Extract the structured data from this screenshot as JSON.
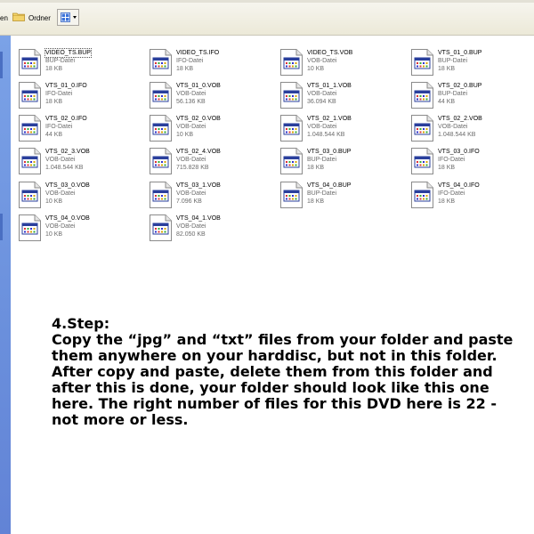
{
  "toolbar": {
    "cut_label": "en",
    "folder_label": "Ordner",
    "view_icon": "thumbnails-view-icon"
  },
  "files": [
    {
      "name": "VIDEO_TS.BUP",
      "type": "BUP-Datei",
      "size": "18 KB",
      "selected": true
    },
    {
      "name": "VIDEO_TS.IFO",
      "type": "IFO-Datei",
      "size": "18 KB"
    },
    {
      "name": "VIDEO_TS.VOB",
      "type": "VOB-Datei",
      "size": "10 KB"
    },
    {
      "name": "VTS_01_0.BUP",
      "type": "BUP-Datei",
      "size": "18 KB"
    },
    {
      "name": "VTS_01_0.IFO",
      "type": "IFO-Datei",
      "size": "18 KB"
    },
    {
      "name": "VTS_01_0.VOB",
      "type": "VOB-Datei",
      "size": "56.136 KB"
    },
    {
      "name": "VTS_01_1.VOB",
      "type": "VOB-Datei",
      "size": "36.094 KB"
    },
    {
      "name": "VTS_02_0.BUP",
      "type": "BUP-Datei",
      "size": "44 KB"
    },
    {
      "name": "VTS_02_0.IFO",
      "type": "IFO-Datei",
      "size": "44 KB"
    },
    {
      "name": "VTS_02_0.VOB",
      "type": "VOB-Datei",
      "size": "10 KB"
    },
    {
      "name": "VTS_02_1.VOB",
      "type": "VOB-Datei",
      "size": "1.048.544 KB"
    },
    {
      "name": "VTS_02_2.VOB",
      "type": "VOB-Datei",
      "size": "1.048.544 KB"
    },
    {
      "name": "VTS_02_3.VOB",
      "type": "VOB-Datei",
      "size": "1.048.544 KB"
    },
    {
      "name": "VTS_02_4.VOB",
      "type": "VOB-Datei",
      "size": "715.828 KB"
    },
    {
      "name": "VTS_03_0.BUP",
      "type": "BUP-Datei",
      "size": "18 KB"
    },
    {
      "name": "VTS_03_0.IFO",
      "type": "IFO-Datei",
      "size": "18 KB"
    },
    {
      "name": "VTS_03_0.VOB",
      "type": "VOB-Datei",
      "size": "10 KB"
    },
    {
      "name": "VTS_03_1.VOB",
      "type": "VOB-Datei",
      "size": "7.096 KB"
    },
    {
      "name": "VTS_04_0.BUP",
      "type": "BUP-Datei",
      "size": "18 KB"
    },
    {
      "name": "VTS_04_0.IFO",
      "type": "IFO-Datei",
      "size": "18 KB"
    },
    {
      "name": "VTS_04_0.VOB",
      "type": "VOB-Datei",
      "size": "10 KB"
    },
    {
      "name": "VTS_04_1.VOB",
      "type": "VOB-Datei",
      "size": "82.050 KB"
    }
  ],
  "file_icon": "media-file-icon",
  "instructions": {
    "title": "4.Step:",
    "body": "Copy the “jpg” and “txt” files from your folder and paste them anywhere on your harddisc, but not in this folder. After copy and paste, delete them from this folder and after this is done, your folder should look like this one here. The right number of files for this DVD here is 22 - not more or less."
  },
  "colors": {
    "sidebar": "#6a8fdc",
    "toolbar": "#ece9d8",
    "icon_header": "#2a3f9c"
  }
}
